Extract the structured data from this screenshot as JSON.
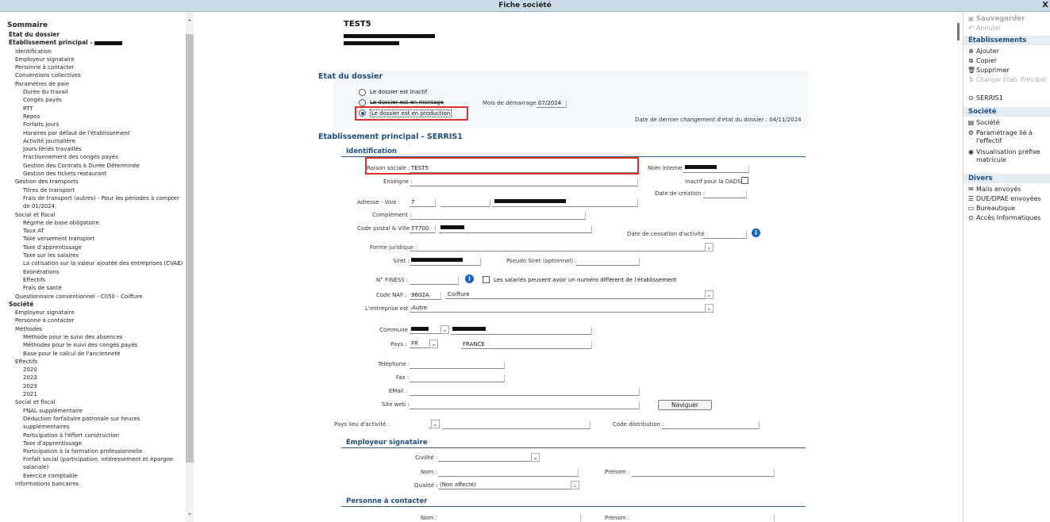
{
  "window": {
    "title": "Fiche société",
    "close": "X"
  },
  "nav": {
    "items": [
      {
        "t": "Sommaire",
        "c": "h0"
      },
      {
        "t": "Etat du dossier",
        "c": "h1"
      },
      {
        "t": "Etablissement principal -",
        "c": "h1"
      },
      {
        "t": "Identification",
        "c": "l1"
      },
      {
        "t": "Employeur signataire",
        "c": "l1"
      },
      {
        "t": "Personne à contacter",
        "c": "l1"
      },
      {
        "t": "Conventions collectives",
        "c": "l1"
      },
      {
        "t": "Paramètres de paie",
        "c": "l1"
      },
      {
        "t": "Durée du travail",
        "c": "l2"
      },
      {
        "t": "Congés payés",
        "c": "l2"
      },
      {
        "t": "RTT",
        "c": "l2"
      },
      {
        "t": "Repos",
        "c": "l2"
      },
      {
        "t": "Forfaits jours",
        "c": "l2"
      },
      {
        "t": "Horaires par défaut de l'établissement",
        "c": "l2"
      },
      {
        "t": "Activité journalière",
        "c": "l2"
      },
      {
        "t": "Jours fériés travaillés",
        "c": "l2"
      },
      {
        "t": "Fractionnement des congés payés",
        "c": "l2"
      },
      {
        "t": "Gestion des Contrats à Durée Déterminée",
        "c": "l2"
      },
      {
        "t": "Gestion des tickets restaurant",
        "c": "l2"
      },
      {
        "t": "Gestion des transports",
        "c": "l1"
      },
      {
        "t": "Titres de transport",
        "c": "l2"
      },
      {
        "t": "Frais de transport (autres) - Pour les périodes à compter de 01/2024",
        "c": "l2w"
      },
      {
        "t": "Social et fiscal",
        "c": "l1"
      },
      {
        "t": "Régime de base obligatoire",
        "c": "l2"
      },
      {
        "t": "Taux AT",
        "c": "l2"
      },
      {
        "t": "Taxe versement transport",
        "c": "l2"
      },
      {
        "t": "Taxe d'apprentissage",
        "c": "l2"
      },
      {
        "t": "Taxe sur les salaires",
        "c": "l2"
      },
      {
        "t": "La cotisation sur la valeur ajoutée des entreprises (CVAE)",
        "c": "l2"
      },
      {
        "t": "Exonérations",
        "c": "l2"
      },
      {
        "t": "Effectifs",
        "c": "l2"
      },
      {
        "t": "Frais de santé",
        "c": "l2"
      },
      {
        "t": "Questionnaire conventionnel - C050 - Coiffure",
        "c": "l1"
      },
      {
        "t": "Société",
        "c": "h1"
      },
      {
        "t": "Employeur signataire",
        "c": "l1"
      },
      {
        "t": "Personne à contacter",
        "c": "l1"
      },
      {
        "t": "Méthodes",
        "c": "l1"
      },
      {
        "t": "Méthode pour le suivi des absences",
        "c": "l2"
      },
      {
        "t": "Méthodes pour le suivi des congés payés",
        "c": "l2"
      },
      {
        "t": "Base pour le calcul de l'ancienneté",
        "c": "l2"
      },
      {
        "t": "Effectifs",
        "c": "l1"
      },
      {
        "t": "2020",
        "c": "l2"
      },
      {
        "t": "2022",
        "c": "l2"
      },
      {
        "t": "2023",
        "c": "l2"
      },
      {
        "t": "2021",
        "c": "l2"
      },
      {
        "t": "Social et fiscal",
        "c": "l1"
      },
      {
        "t": "FNAL supplémentaire",
        "c": "l2"
      },
      {
        "t": "Déduction forfaitaire patronale sur heures supplémentaires",
        "c": "l2w"
      },
      {
        "t": "Participation à l'effort construction",
        "c": "l2"
      },
      {
        "t": "Taxe d'apprentissage",
        "c": "l2"
      },
      {
        "t": "Participation à la formation professionnelle",
        "c": "l2"
      },
      {
        "t": "Forfait social (participation, intéressement et épargne salariale)",
        "c": "l2w"
      },
      {
        "t": "Exercice comptable",
        "c": "l2"
      },
      {
        "t": "Informations bancaires",
        "c": "l1"
      }
    ]
  },
  "header": {
    "company": "TEST5"
  },
  "etat": {
    "title": "Etat du dossier",
    "opt1": "Le dossier est inactif",
    "opt2": "Le dossier est en montage",
    "opt3": "Le dossier est en production",
    "mois_label": "Mois de démarrage :",
    "mois_value": "07/2024",
    "last_change": "Date de dernier changement d'état du dossier : 04/11/2024"
  },
  "etab": {
    "title": "Etablissement principal - SERRIS1",
    "ident_title": "Identification",
    "raison_label": "Raison sociale :",
    "raison_value": "TEST5",
    "nom_interne_label": "Nom interne :",
    "enseigne_label": "Enseigne :",
    "inactif_label": "Inactif pour la DADS",
    "date_creation_label": "Date de création :",
    "adresse_label": "Adresse - Voie :",
    "adresse_num": "7",
    "complement_label": "Complément :",
    "cp_label": "Code postal & Ville :",
    "cp_value": "77700",
    "cessation_label": "Date de cessation d'activité :",
    "forme_label": "Forme juridique :",
    "siret_label": "Siret :",
    "pseudo_label": "Pseudo Siret (optionnel) :",
    "finess_label": "N° FINESS :",
    "salaries_label": "Les salariés peuvent avoir un numéro différent de l'établissement",
    "naf_label": "Code NAF :",
    "naf_code": "9602A",
    "naf_text": "Coiffure",
    "entreprise_label": "L'entreprise est :",
    "entreprise_value": "Autre",
    "commune_label": "Commune :",
    "pays_label": "Pays :",
    "pays_code": "FR",
    "pays_text": "FRANCE",
    "tel_label": "Téléphone :",
    "fax_label": "Fax :",
    "email_label": "EMail :",
    "site_label": "Site web :",
    "naviguer": "Naviguer",
    "pays_lieu_label": "Pays lieu d'activité :",
    "code_distrib_label": "Code distribution :"
  },
  "employeur": {
    "title": "Employeur signataire",
    "civilite_label": "Civilité :",
    "nom_label": "Nom :",
    "prenom_label": "Prénom :",
    "qualite_label": "Qualité :",
    "qualite_value": "(Non affecté)"
  },
  "contact": {
    "title": "Personne à contacter",
    "nom_label": "Nom :",
    "prenom_label": "Prénom :"
  },
  "right": {
    "save": "Sauvegarder",
    "cancel": "Annuler",
    "etab_head": "Établissements",
    "add": "Ajouter",
    "copy": "Copier",
    "delete": "Supprimer",
    "change": "Changer Etab. Principal",
    "serris": "SERRIS1",
    "societe_head": "Société",
    "societe": "Société",
    "param1": "Paramétrage lié à",
    "param2": "l'effectif",
    "visu1": "Visualisation préfixe",
    "visu2": "matricule",
    "divers_head": "Divers",
    "mails": "Mails envoyés",
    "due": "DUE/DPAE envoyées",
    "bureau": "Bureautique",
    "acces": "Accès Informatiques"
  }
}
